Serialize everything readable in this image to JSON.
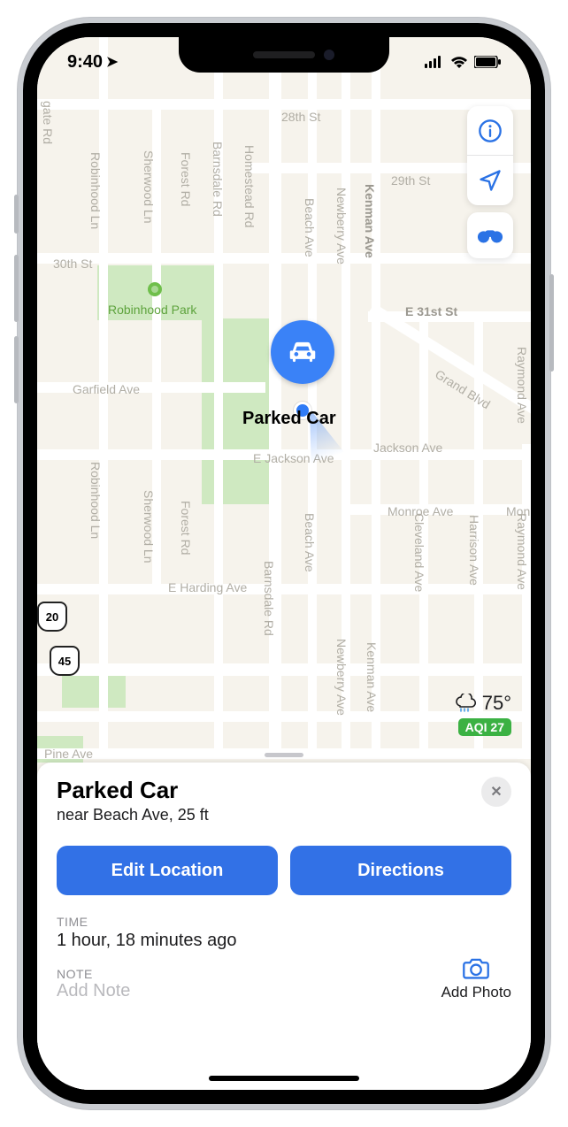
{
  "status": {
    "time": "9:40",
    "location_glyph": "➤"
  },
  "map": {
    "streets_h": [
      "28th St",
      "29th St",
      "30th St",
      "E 31st St",
      "Garfield Ave",
      "E Jackson Ave",
      "Jackson Ave",
      "Monroe Ave",
      "Monroe",
      "E Harding Ave",
      "Pine Ave"
    ],
    "streets_v": [
      "gate Rd",
      "Robinhood Ln",
      "Sherwood Ln",
      "Forest Rd",
      "Barnsdale Rd",
      "Homestead Rd",
      "Beach Ave",
      "Newberry Ave",
      "Kenman Ave",
      "Cleveland Ave",
      "Harrison Ave",
      "Raymond Ave",
      "Raymond Ave",
      "Newberry Ave",
      "Beach Ave",
      "Barnsdale Rd",
      "Sherwood Ln",
      "Forest Rd",
      "Robinhood Ln",
      "Kenman Ave",
      "Grand Blvd"
    ],
    "park_name": "Robinhood Park",
    "shields": [
      "20",
      "45"
    ],
    "marker_label": "Parked Car"
  },
  "tools": {
    "info": "info",
    "location": "location",
    "binoculars": "binoculars"
  },
  "weather": {
    "temp": "75°",
    "aqi": "AQI 27"
  },
  "sheet": {
    "title": "Parked Car",
    "subtitle": "near Beach Ave, 25 ft",
    "close": "✕",
    "edit_label": "Edit Location",
    "directions_label": "Directions",
    "time_label": "TIME",
    "time_value": "1 hour, 18 minutes ago",
    "note_label": "NOTE",
    "add_note_placeholder": "Add Note",
    "add_photo_label": "Add Photo"
  }
}
